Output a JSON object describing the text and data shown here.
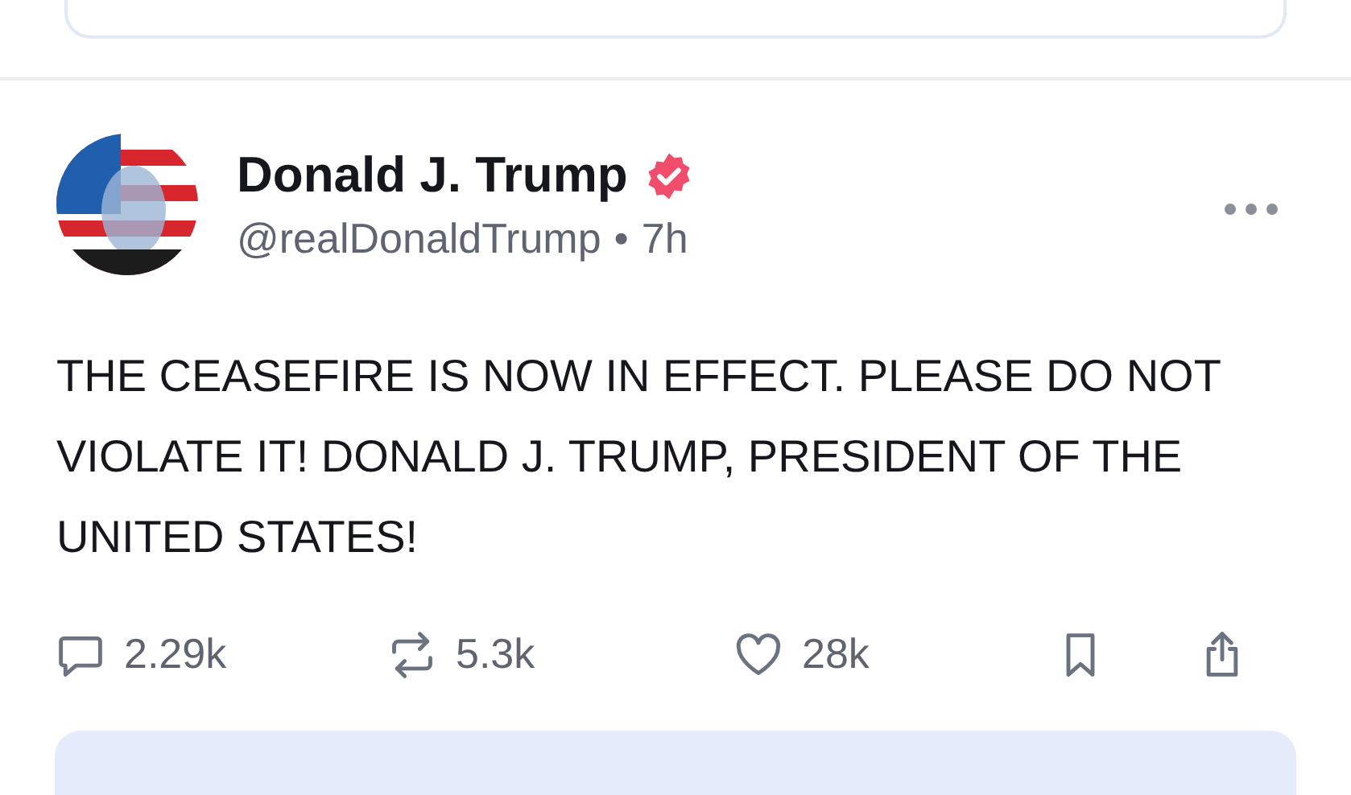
{
  "post": {
    "author": "Donald J. Trump",
    "verified": true,
    "handle": "@realDonaldTrump",
    "separator": "•",
    "time": "7h",
    "text": "THE CEASEFIRE IS NOW IN EFFECT. PLEASE DO NOT VIOLATE IT! DONALD J. TRUMP, PRESIDENT OF THE UNITED STATES!",
    "actions": [
      {
        "kind": "reply",
        "count": "2.29k"
      },
      {
        "kind": "repost",
        "count": "5.3k"
      },
      {
        "kind": "like",
        "count": "28k"
      },
      {
        "kind": "bookmark"
      },
      {
        "kind": "share"
      }
    ]
  }
}
